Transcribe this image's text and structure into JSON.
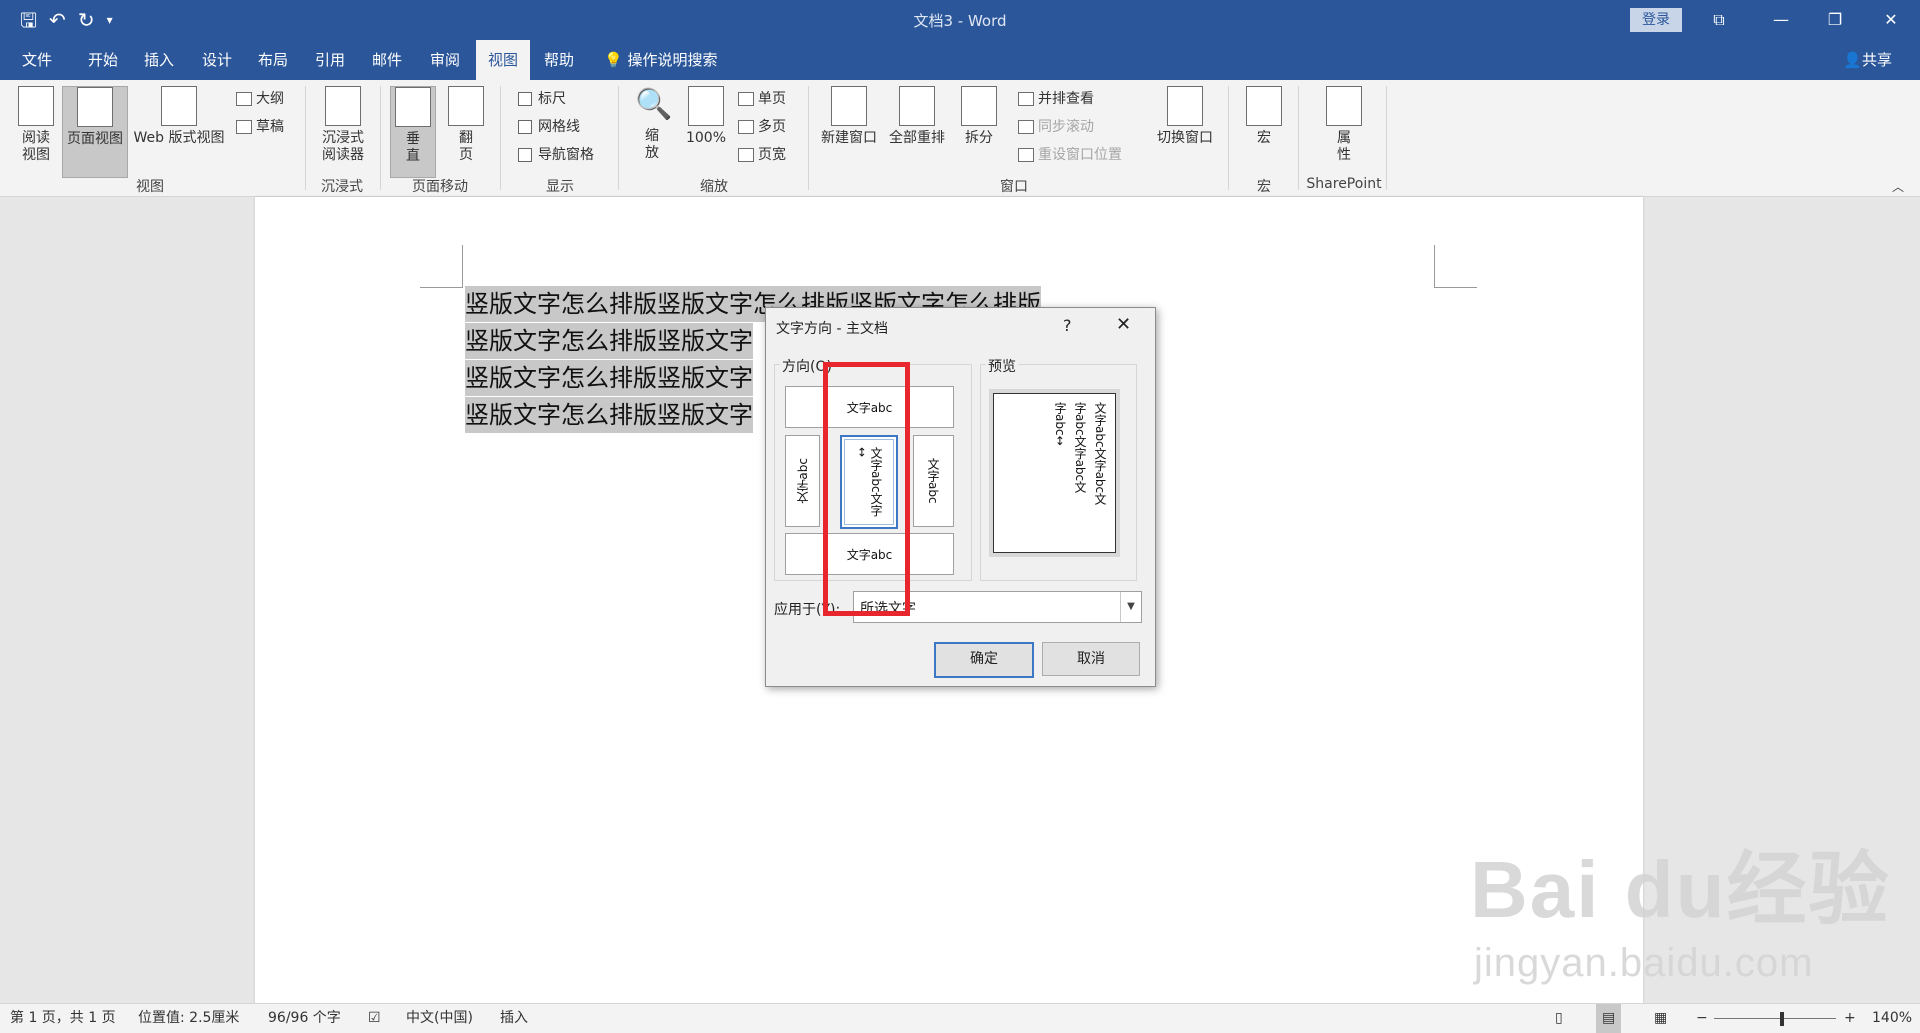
{
  "colors": {
    "accent": "#2b579a",
    "highlight": "#e8262d"
  },
  "title": "文档3  -  Word",
  "login_label": "登录",
  "tabs": [
    "文件",
    "开始",
    "插入",
    "设计",
    "布局",
    "引用",
    "邮件",
    "审阅",
    "视图",
    "帮助"
  ],
  "active_tab": "视图",
  "search_label": "操作说明搜索",
  "share_label": "共享",
  "ribbon": {
    "views": {
      "read": "阅读\n视图",
      "print": "页面视图",
      "web": "Web 版式视图",
      "outline": "大纲",
      "draft": "草稿",
      "label": "视图"
    },
    "immersive": {
      "reader": "沉浸式\n阅读器",
      "label": "沉浸式"
    },
    "page_move": {
      "vertical": "垂\n直",
      "side": "翻\n页",
      "label": "页面移动"
    },
    "show": {
      "ruler": "标尺",
      "grid": "网格线",
      "nav": "导航窗格",
      "label": "显示"
    },
    "zoom": {
      "zoom": "缩\n放",
      "hundred": "100%",
      "one": "单页",
      "multi": "多页",
      "width": "页宽",
      "label": "缩放"
    },
    "window": {
      "new": "新建窗口",
      "arrange": "全部重排",
      "split": "拆分",
      "side": "并排查看",
      "sync": "同步滚动",
      "reset": "重设窗口位置",
      "switch": "切换窗口",
      "label": "窗口"
    },
    "macros": {
      "macro": "宏",
      "label": "宏"
    },
    "sharepoint": {
      "props": "属\n性",
      "label": "SharePoint"
    }
  },
  "document": {
    "lines": [
      "竖版文字怎么排版竖版文字怎么排版竖版文字怎么排版",
      "竖版文字怎么排版竖版文字",
      "竖版文字怎么排版竖版文字",
      "竖版文字怎么排版竖版文字"
    ]
  },
  "dialog": {
    "title": "文字方向 - 主文档",
    "help": "?",
    "close": "✕",
    "orientation_label": "方向(O)",
    "preview_label": "预览",
    "options": {
      "horizontal": "文字abc",
      "left_vertical": "文字abc",
      "center_vertical": "文字abc文字↔",
      "right_vertical": "文字abc",
      "bottom": "文字abc"
    },
    "preview_text": [
      "文字abc文字abc文",
      "字abc文字abc文",
      "字abc↔"
    ],
    "apply_label": "应用于(Y):",
    "apply_value": "所选文字",
    "ok": "确定",
    "cancel": "取消"
  },
  "status": {
    "page": "第 1 页，共 1 页",
    "position": "位置值: 2.5厘米",
    "words": "96/96 个字",
    "language": "中文(中国)",
    "mode": "插入",
    "zoom": "140%"
  },
  "watermark": {
    "brand": "Bai du经验",
    "url": "jingyan.baidu.com"
  }
}
